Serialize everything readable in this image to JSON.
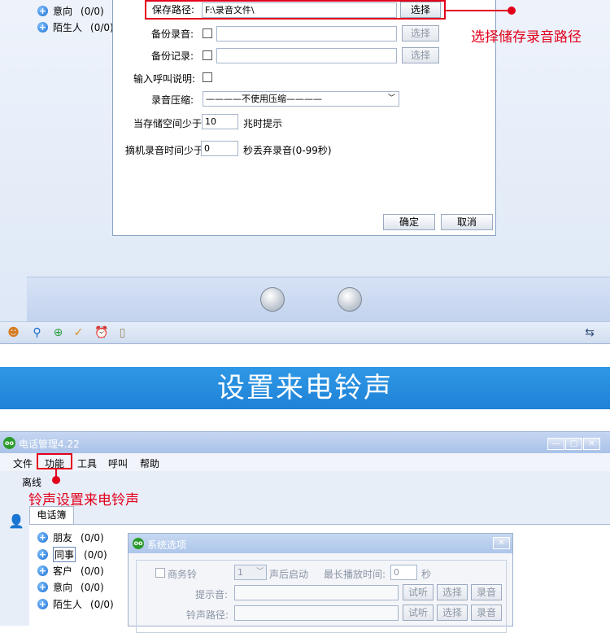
{
  "top": {
    "groups": [
      {
        "name": "意向",
        "count": "(0/0)"
      },
      {
        "name": "陌生人",
        "count": "(0/0)"
      }
    ],
    "dialog": {
      "save_path_label": "保存路径:",
      "save_path_value": "F:\\录音文件\\",
      "select_label": "选择",
      "backup_record_label": "备份录音:",
      "backup_log_label": "备份记录:",
      "input_call_desc_label": "输入呼叫说明:",
      "compress_label": "录音压缩:",
      "compress_value": "————不使用压缩————",
      "space_prefix": "当存储空间少于",
      "space_value": "10",
      "space_suffix": "兆时提示",
      "hangup_prefix": "摘机录音时间少于",
      "hangup_value": "0",
      "hangup_suffix": "秒丢弃录音(0-99秒)",
      "ok_label": "确定",
      "cancel_label": "取消"
    },
    "annotation": "选择储存录音路径"
  },
  "banner": {
    "title": "设置来电铃声"
  },
  "bottom": {
    "window_title": "电话管理4.22",
    "menus": [
      "文件",
      "功能",
      "工具",
      "呼叫",
      "帮助"
    ],
    "status": "离线",
    "annotation": "铃声设置来电铃声",
    "tab_phonebook": "电话簿",
    "groups": [
      {
        "name": "朋友",
        "count": "(0/0)"
      },
      {
        "name": "同事",
        "count": "(0/0)"
      },
      {
        "name": "客户",
        "count": "(0/0)"
      },
      {
        "name": "意向",
        "count": "(0/0)"
      },
      {
        "name": "陌生人",
        "count": "(0/0)"
      }
    ],
    "dialog": {
      "title": "系统选项",
      "business_ring_label": "商务铃",
      "ring_count_value": "1",
      "after_ring_label": "声后启动",
      "max_play_label": "最长播放时间:",
      "max_play_value": "0",
      "seconds_label": "秒",
      "prompt_sound_label": "提示音:",
      "ring_path_label": "铃声路径:",
      "listen_label": "试听",
      "select_label": "选择",
      "record_label": "录音"
    }
  },
  "colors": {
    "accent_red": "#e3001b",
    "banner_blue": "#2a90e0"
  }
}
